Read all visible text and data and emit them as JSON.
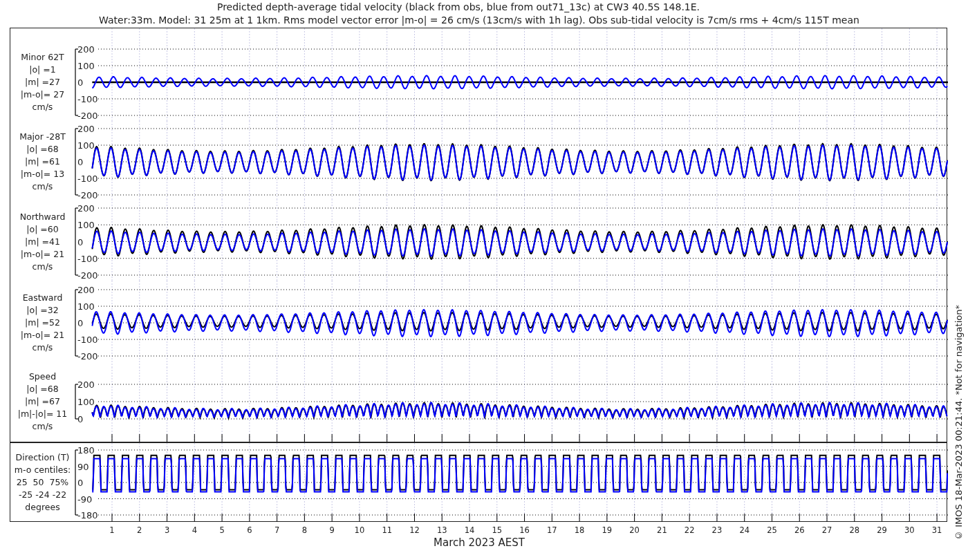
{
  "title_lines": [
    "Predicted depth-average tidal velocity (black from obs, blue from out71_13c) at CW3 40.5S 148.1E.",
    "Water:33m. Model: 31 25m at 1 1km. Rms model vector error |m-o| = 26 cm/s (13cm/s with 1h lag). Obs sub-tidal velocity is 7cm/s rms + 4cm/s 115T mean"
  ],
  "panels": [
    {
      "kind": "minor",
      "label_lines": [
        "Minor 62T",
        "|o| =1",
        "|m| =27",
        "|m-o|= 27",
        "cm/s"
      ],
      "yticks": [
        "200",
        "100",
        "0",
        "-100",
        "-200"
      ]
    },
    {
      "kind": "major",
      "label_lines": [
        "Major -28T",
        "|o| =68",
        "|m| =61",
        "|m-o|= 13",
        "cm/s"
      ],
      "yticks": [
        "200",
        "100",
        "0",
        "-100",
        "-200"
      ]
    },
    {
      "kind": "northward",
      "label_lines": [
        "Northward",
        "|o| =60",
        "|m| =41",
        "|m-o|= 21",
        "cm/s"
      ],
      "yticks": [
        "200",
        "100",
        "0",
        "-100",
        "-200"
      ]
    },
    {
      "kind": "eastward",
      "label_lines": [
        "Eastward",
        "|o| =32",
        "|m| =52",
        "|m-o|= 21",
        "cm/s"
      ],
      "yticks": [
        "200",
        "100",
        "0",
        "-100",
        "-200"
      ]
    },
    {
      "kind": "speed",
      "label_lines": [
        "Speed",
        "|o| =68",
        "|m| =67",
        "|m|-|o|= 11",
        "cm/s"
      ],
      "yticks": [
        "200",
        "100",
        "0"
      ]
    },
    {
      "kind": "direction",
      "label_lines": [
        "Direction (T)",
        "m-o centiles:",
        "25  50  75%",
        "-25 -24 -22",
        "degrees"
      ],
      "yticks": [
        "180",
        "90",
        "0",
        "-90",
        "-180"
      ]
    }
  ],
  "x_tick_labels": [
    "1",
    "2",
    "3",
    "4",
    "5",
    "6",
    "7",
    "8",
    "9",
    "10",
    "11",
    "12",
    "13",
    "14",
    "15",
    "16",
    "17",
    "18",
    "19",
    "20",
    "21",
    "22",
    "23",
    "24",
    "25",
    "26",
    "27",
    "28",
    "29",
    "30",
    "31"
  ],
  "xlabel": "March 2023 AEST",
  "credit": "© IMOS 18-Mar-2023 00:21:44. *Not for navigation*"
}
